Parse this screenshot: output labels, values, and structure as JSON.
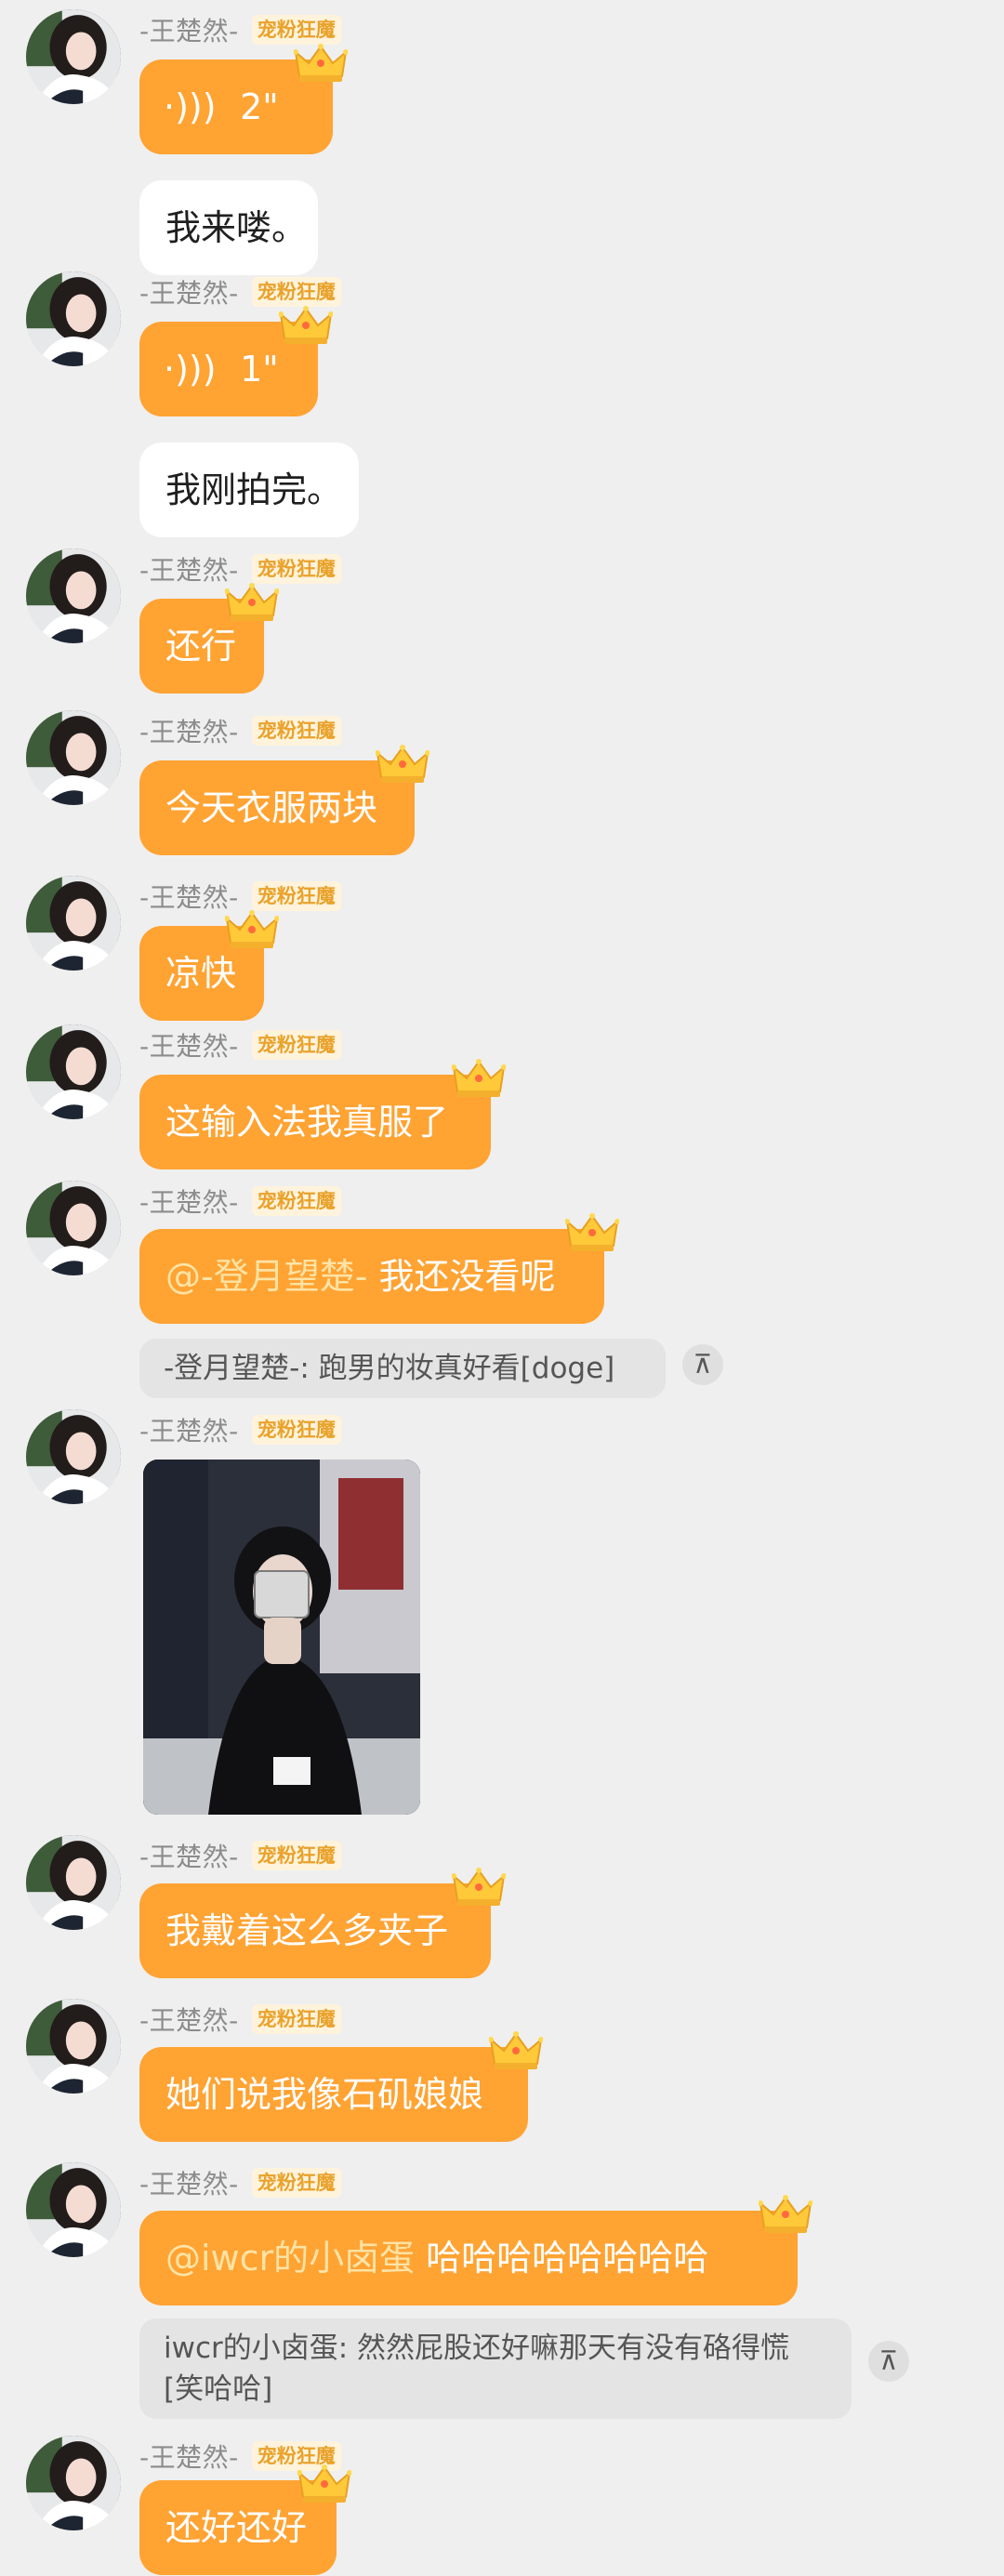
{
  "sender": {
    "name": "-王楚然-",
    "tag": "宠粉狂魔"
  },
  "messages": {
    "m1": {
      "duration": "2\""
    },
    "m2": {
      "text": "我来喽。"
    },
    "m3": {
      "duration": "1\""
    },
    "m4": {
      "text": "我刚拍完。"
    },
    "m5": {
      "text": "还行"
    },
    "m6": {
      "text": "今天衣服两块"
    },
    "m7": {
      "text": "凉快"
    },
    "m8": {
      "text": "这输入法我真服了"
    },
    "m9": {
      "mention": "@-登月望楚-",
      "text": "我还没看呢",
      "quote": "-登月望楚-: 跑男的妆真好看[doge]"
    },
    "m11": {
      "text": "我戴着这么多夹子"
    },
    "m12": {
      "text": "她们说我像石矶娘娘"
    },
    "m13": {
      "mention": "@iwcr的小卤蛋",
      "text": "哈哈哈哈哈哈哈哈",
      "quote_line1": "iwcr的小卤蛋: 然然屁股还好嘛那天有没有硌得慌",
      "quote_line2": "[笑哈哈]"
    },
    "m14": {
      "text": "还好还好"
    }
  },
  "icons": {
    "voice": "voice-wave-icon",
    "crown": "crown-icon",
    "jump_up": "arrow-up-icon"
  },
  "colors": {
    "bubble": "#ffa333",
    "background": "#efefef",
    "tag_text": "#e9a22b"
  }
}
